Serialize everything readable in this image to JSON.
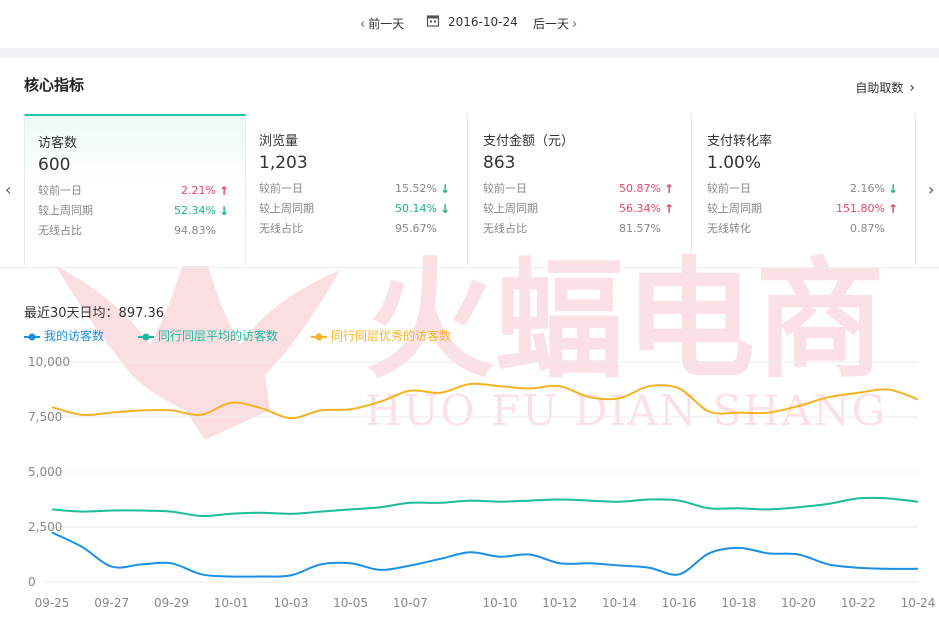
{
  "date_nav": {
    "prev": "前一天",
    "date": "2016-10-24",
    "next": "后一天"
  },
  "section": {
    "title": "核心指标",
    "self_fetch": "自助取数"
  },
  "cards": [
    {
      "name": "访客数",
      "value": "600",
      "rows": [
        {
          "label": "较前一日",
          "value": "2.21%",
          "trend": "up"
        },
        {
          "label": "较上周同期",
          "value": "52.34%",
          "trend": "down"
        },
        {
          "label": "无线占比",
          "value": "94.83%",
          "trend": "none"
        }
      ]
    },
    {
      "name": "浏览量",
      "value": "1,203",
      "rows": [
        {
          "label": "较前一日",
          "value": "15.52%",
          "trend": "down"
        },
        {
          "label": "较上周同期",
          "value": "50.14%",
          "trend": "down"
        },
        {
          "label": "无线占比",
          "value": "95.67%",
          "trend": "none"
        }
      ]
    },
    {
      "name": "支付金额（元）",
      "value": "863",
      "rows": [
        {
          "label": "较前一日",
          "value": "50.87%",
          "trend": "up"
        },
        {
          "label": "较上周同期",
          "value": "56.34%",
          "trend": "up"
        },
        {
          "label": "无线占比",
          "value": "81.57%",
          "trend": "none"
        }
      ]
    },
    {
      "name": "支付转化率",
      "value": "1.00%",
      "rows": [
        {
          "label": "较前一日",
          "value": "2.16%",
          "trend": "down"
        },
        {
          "label": "较上周同期",
          "value": "151.80%",
          "trend": "up"
        },
        {
          "label": "无线转化",
          "value": "0.87%",
          "trend": "none"
        }
      ]
    }
  ],
  "summary": {
    "avg_text": "最近30天日均：897.36"
  },
  "watermark": {
    "cn": "火蝠电商",
    "en": "HUO FU DIAN SHANG"
  },
  "colors": {
    "mine": "#1a8fe3",
    "peer_avg": "#1bbc9b",
    "peer_top": "#f5b324",
    "up": "#e9446a",
    "down": "#1bb38b",
    "accent": "#20c9a0"
  },
  "chart_data": {
    "type": "line",
    "x": [
      "09-25",
      "09-26",
      "09-27",
      "09-28",
      "09-29",
      "09-30",
      "10-01",
      "10-02",
      "10-03",
      "10-04",
      "10-05",
      "10-06",
      "10-07",
      "10-08",
      "10-09",
      "10-10",
      "10-11",
      "10-12",
      "10-13",
      "10-14",
      "10-15",
      "10-16",
      "10-17",
      "10-18",
      "10-19",
      "10-20",
      "10-21",
      "10-22",
      "10-23",
      "10-24"
    ],
    "xticks": [
      "09-25",
      "09-27",
      "09-29",
      "10-01",
      "10-03",
      "10-05",
      "10-07",
      "10-10",
      "10-12",
      "10-14",
      "10-16",
      "10-18",
      "10-20",
      "10-22",
      "10-24"
    ],
    "yticks": [
      "0",
      "2,500",
      "5,000",
      "7,500",
      "10,000"
    ],
    "ylim": [
      0,
      10000
    ],
    "legend_position": "top-left",
    "grid": true,
    "series": [
      {
        "name": "我的访客数",
        "color_key": "mine",
        "values": [
          2250,
          1600,
          700,
          800,
          850,
          350,
          250,
          250,
          300,
          800,
          850,
          550,
          750,
          1050,
          1350,
          1150,
          1250,
          850,
          850,
          750,
          650,
          350,
          1300,
          1550,
          1300,
          1250,
          800,
          650,
          600,
          600
        ]
      },
      {
        "name": "同行同层平均的访客数",
        "color_key": "peer_avg",
        "values": [
          3300,
          3200,
          3250,
          3250,
          3200,
          3000,
          3100,
          3150,
          3100,
          3200,
          3300,
          3400,
          3600,
          3600,
          3700,
          3650,
          3700,
          3750,
          3700,
          3650,
          3750,
          3700,
          3350,
          3350,
          3300,
          3400,
          3550,
          3800,
          3800,
          3650
        ]
      },
      {
        "name": "同行同层优秀的访客数",
        "color_key": "peer_top",
        "values": [
          7950,
          7600,
          7700,
          7800,
          7800,
          7600,
          8150,
          7900,
          7450,
          7800,
          7850,
          8200,
          8700,
          8600,
          9000,
          8900,
          8800,
          8900,
          8400,
          8350,
          8900,
          8800,
          7750,
          7700,
          7700,
          8000,
          8400,
          8600,
          8750,
          8300
        ]
      }
    ]
  }
}
